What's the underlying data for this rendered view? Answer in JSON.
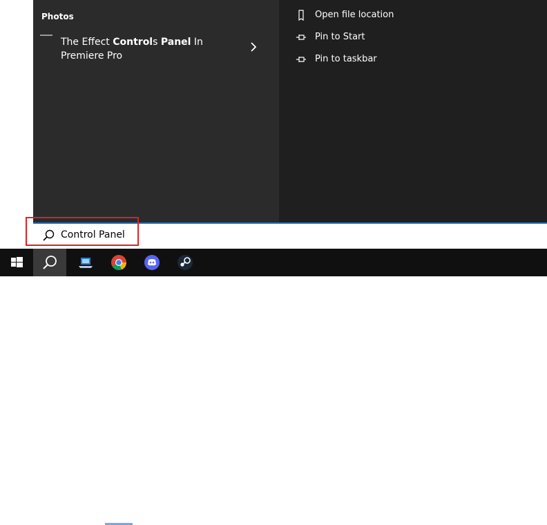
{
  "left": {
    "section_title": "Photos",
    "result": {
      "pre": "The Effect ",
      "bold1": "Control",
      "mid": "s ",
      "bold2": "Panel",
      "post": " In",
      "line2": "Premiere Pro"
    }
  },
  "actions": [
    {
      "label": "Open file location",
      "icon": "folder-icon"
    },
    {
      "label": "Pin to Start",
      "icon": "pin-icon"
    },
    {
      "label": "Pin to taskbar",
      "icon": "pin-icon"
    }
  ],
  "search": {
    "value": "Control Panel"
  },
  "taskbar": {
    "items": [
      "windows-start-icon",
      "search-icon",
      "laptop-app-icon",
      "chrome-icon",
      "discord-icon",
      "steam-icon"
    ]
  },
  "colors": {
    "search_border": "#1a73c7",
    "highlight": "#e02020"
  }
}
